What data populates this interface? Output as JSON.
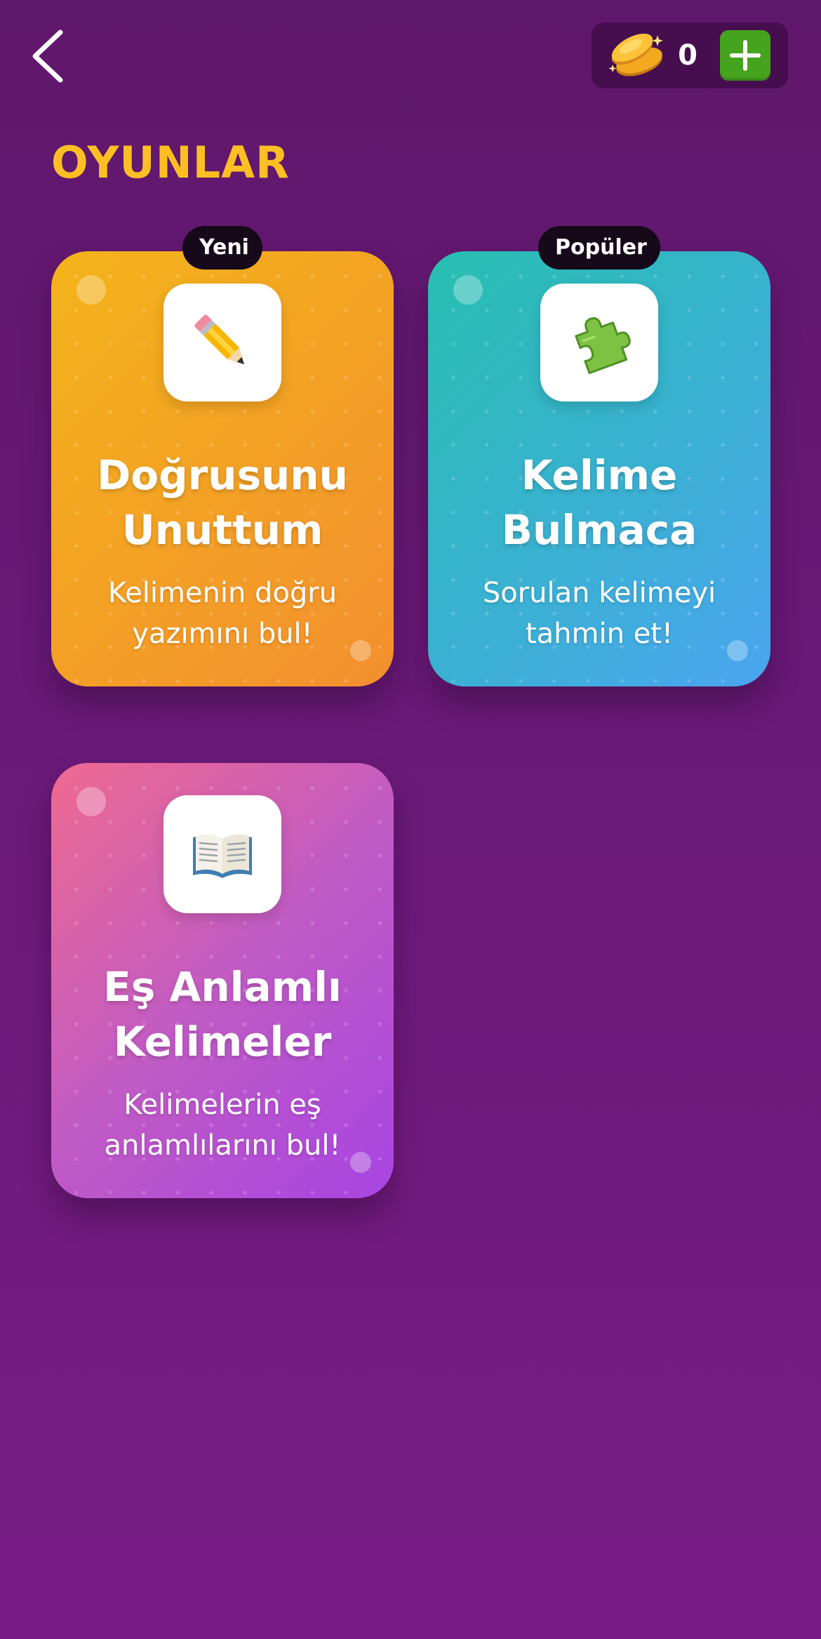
{
  "header": {
    "coin_count": "0"
  },
  "page_title": "OYUNLAR",
  "cards": [
    {
      "badge": "Yeni",
      "title_line1": "Doğrusunu",
      "title_line2": "Unuttum",
      "desc_line1": "Kelimenin doğru",
      "desc_line2": "yazımını bul!",
      "icon": "pencil-icon",
      "gradient_from": "#f3b41a",
      "gradient_to": "#f38f2f"
    },
    {
      "badge": "Popüler",
      "title_line1": "Kelime",
      "title_line2": "Bulmaca",
      "desc_line1": "Sorulan kelimeyi",
      "desc_line2": "tahmin et!",
      "icon": "puzzle-piece-icon",
      "gradient_from": "#27bfb0",
      "gradient_to": "#4aa5ef"
    },
    {
      "title_line1": "Eş Anlamlı",
      "title_line2": "Kelimeler",
      "desc_line1": "Kelimelerin eş",
      "desc_line2": "anlamlılarını bul!",
      "icon": "open-book-icon",
      "gradient_from": "#ef6a8f",
      "gradient_to": "#a744e2"
    }
  ],
  "colors": {
    "background": "#6a1a78",
    "title": "#fbbf24",
    "add_button": "#46a31d",
    "badge": "#15091a"
  }
}
